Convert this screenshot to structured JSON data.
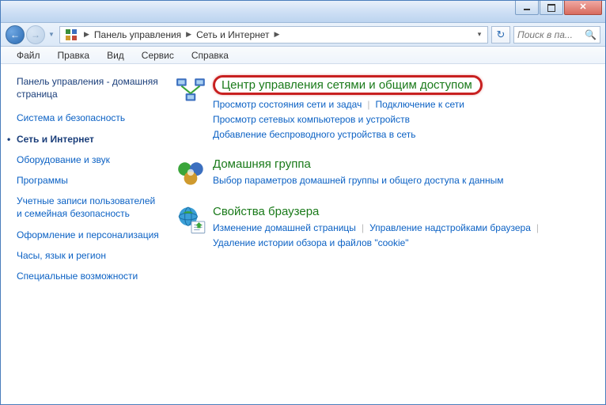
{
  "breadcrumb": {
    "root": "Панель управления",
    "current": "Сеть и Интернет"
  },
  "search": {
    "placeholder": "Поиск в па..."
  },
  "menu": {
    "file": "Файл",
    "edit": "Правка",
    "view": "Вид",
    "tools": "Сервис",
    "help": "Справка"
  },
  "sidebar": {
    "home": "Панель управления - домашняя страница",
    "items": [
      "Система и безопасность",
      "Сеть и Интернет",
      "Оборудование и звук",
      "Программы",
      "Учетные записи пользователей и семейная безопасность",
      "Оформление и персонализация",
      "Часы, язык и регион",
      "Специальные возможности"
    ]
  },
  "cats": {
    "c1": {
      "title": "Центр управления сетями и общим доступом",
      "l1": "Просмотр состояния сети и задач",
      "l2": "Подключение к сети",
      "l3": "Просмотр сетевых компьютеров и устройств",
      "l4": "Добавление беспроводного устройства в сеть"
    },
    "c2": {
      "title": "Домашняя группа",
      "l1": "Выбор параметров домашней группы и общего доступа к данным"
    },
    "c3": {
      "title": "Свойства браузера",
      "l1": "Изменение домашней страницы",
      "l2": "Управление надстройками браузера",
      "l3": "Удаление истории обзора и файлов \"cookie\""
    }
  }
}
